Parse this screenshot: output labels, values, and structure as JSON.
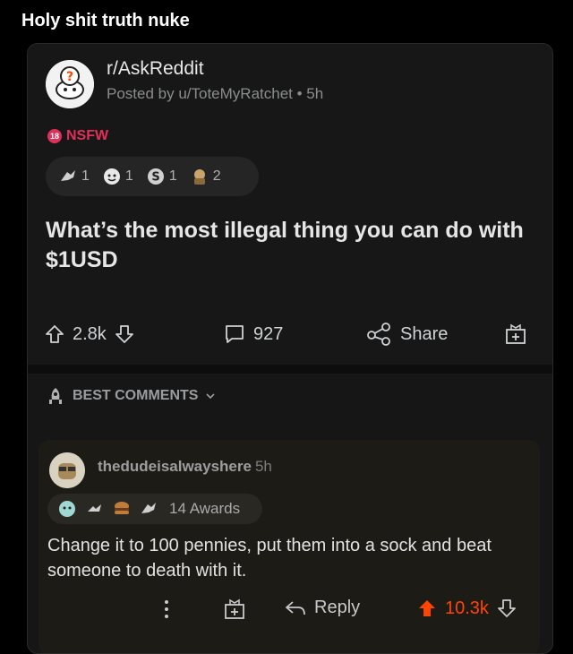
{
  "caption": "Holy shit truth nuke",
  "post": {
    "subreddit": "r/AskReddit",
    "posted_by": "Posted by u/ToteMyRatchet • 5h",
    "nsfw_label": "NSFW",
    "nsfw_badge": "18",
    "awards": [
      {
        "icon": "silver-award-icon",
        "count": "1"
      },
      {
        "icon": "wholesome-award-icon",
        "count": "1"
      },
      {
        "icon": "s-award-icon",
        "count": "1"
      },
      {
        "icon": "animated-award-icon",
        "count": "2"
      }
    ],
    "title": "What’s the most illegal thing you can do with $1USD",
    "upvotes": "2.8k",
    "comments": "927",
    "share_label": "Share"
  },
  "sort": {
    "label": "BEST COMMENTS"
  },
  "comment": {
    "username": "thedudeisalwayshere",
    "time": "5h",
    "awards_text": "14 Awards",
    "body": "Change it to 100 pennies, put them into a sock and beat someone to death with it.",
    "reply_label": "Reply",
    "score": "10.3k"
  },
  "colors": {
    "accent": "#ff4500",
    "nsfw": "#e0305a"
  }
}
